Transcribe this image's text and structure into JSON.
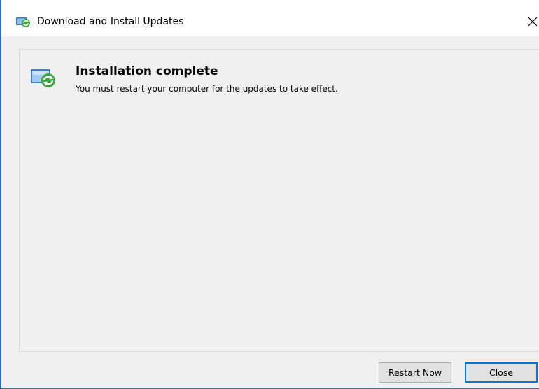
{
  "window": {
    "title": "Download and Install Updates"
  },
  "status": {
    "heading": "Installation complete",
    "message": "You must restart your computer for the updates to take effect."
  },
  "buttons": {
    "restart_label": "Restart Now",
    "close_label": "Close"
  },
  "icons": {
    "title_icon": "windows-update-icon",
    "status_icon": "windows-update-icon",
    "close_icon": "close-icon"
  },
  "colors": {
    "window_border": "#1a73c9",
    "default_button_border": "#0078d7",
    "update_arrow_green": "#3ea33e",
    "monitor_blue": "#3a7fc7"
  }
}
